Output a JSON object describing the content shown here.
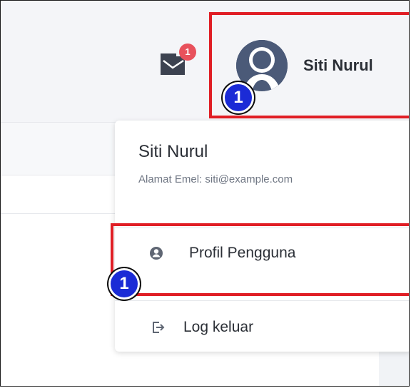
{
  "header": {
    "notification_count": "1",
    "user_name": "Siti Nurul"
  },
  "dropdown": {
    "name": "Siti Nurul",
    "email": "Alamat Emel: siti@example.com",
    "items": [
      {
        "label": "Profil Pengguna",
        "icon": "user-circle-icon"
      },
      {
        "label": "Log keluar",
        "icon": "logout-icon"
      }
    ]
  },
  "annotations": {
    "step_badges": [
      "1",
      "1"
    ],
    "highlight_color": "#e01e25",
    "badge_color": "#1b2bd6"
  },
  "colors": {
    "notification_badge": "#e8515c",
    "avatar": "#4b5a78"
  }
}
